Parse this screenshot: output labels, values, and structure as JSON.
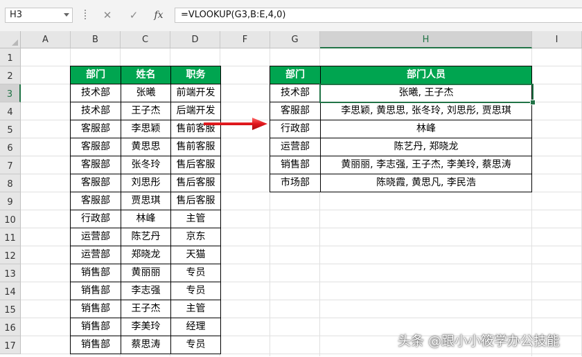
{
  "formula_bar": {
    "name_box": "H3",
    "cancel_icon": "✕",
    "enter_icon": "✓",
    "fx_label": "fx",
    "formula": "=VLOOKUP(G3,B:E,4,0)"
  },
  "sheet": {
    "columns": [
      "A",
      "B",
      "C",
      "D",
      "F",
      "G",
      "H",
      "I"
    ],
    "rows": [
      "1",
      "2",
      "3",
      "4",
      "5",
      "6",
      "7",
      "8",
      "9",
      "10",
      "11",
      "12",
      "13",
      "14",
      "15",
      "16",
      "17"
    ],
    "selected_cell": "H3"
  },
  "left_table": {
    "headers": [
      "部门",
      "姓名",
      "职务"
    ],
    "rows": [
      [
        "技术部",
        "张曦",
        "前端开发"
      ],
      [
        "技术部",
        "王子杰",
        "后端开发"
      ],
      [
        "客服部",
        "李思颖",
        "售前客服"
      ],
      [
        "客服部",
        "黄思思",
        "售前客服"
      ],
      [
        "客服部",
        "张冬玲",
        "售后客服"
      ],
      [
        "客服部",
        "刘思彤",
        "售后客服"
      ],
      [
        "客服部",
        "贾思琪",
        "售后客服"
      ],
      [
        "行政部",
        "林峰",
        "主管"
      ],
      [
        "运营部",
        "陈艺丹",
        "京东"
      ],
      [
        "运营部",
        "郑晓龙",
        "天猫"
      ],
      [
        "销售部",
        "黄丽丽",
        "专员"
      ],
      [
        "销售部",
        "李志强",
        "专员"
      ],
      [
        "销售部",
        "王子杰",
        "主管"
      ],
      [
        "销售部",
        "李美玲",
        "经理"
      ],
      [
        "销售部",
        "蔡思涛",
        "专员"
      ]
    ]
  },
  "right_table": {
    "headers": [
      "部门",
      "部门人员"
    ],
    "rows": [
      [
        "技术部",
        "张曦, 王子杰"
      ],
      [
        "客服部",
        "李思颖, 黄思思, 张冬玲, 刘思彤, 贾思琪"
      ],
      [
        "行政部",
        "林峰"
      ],
      [
        "运营部",
        "陈艺丹, 郑晓龙"
      ],
      [
        "销售部",
        "黄丽丽, 李志强, 王子杰, 李美玲, 蔡思涛"
      ],
      [
        "市场部",
        "陈晓霞, 黄思凡, 李民浩"
      ]
    ]
  },
  "watermark": "头条 @跟小小筱学办公技能",
  "colors": {
    "header_green": "#00a550",
    "selection_green": "#217346",
    "arrow_red": "#e0161b"
  }
}
